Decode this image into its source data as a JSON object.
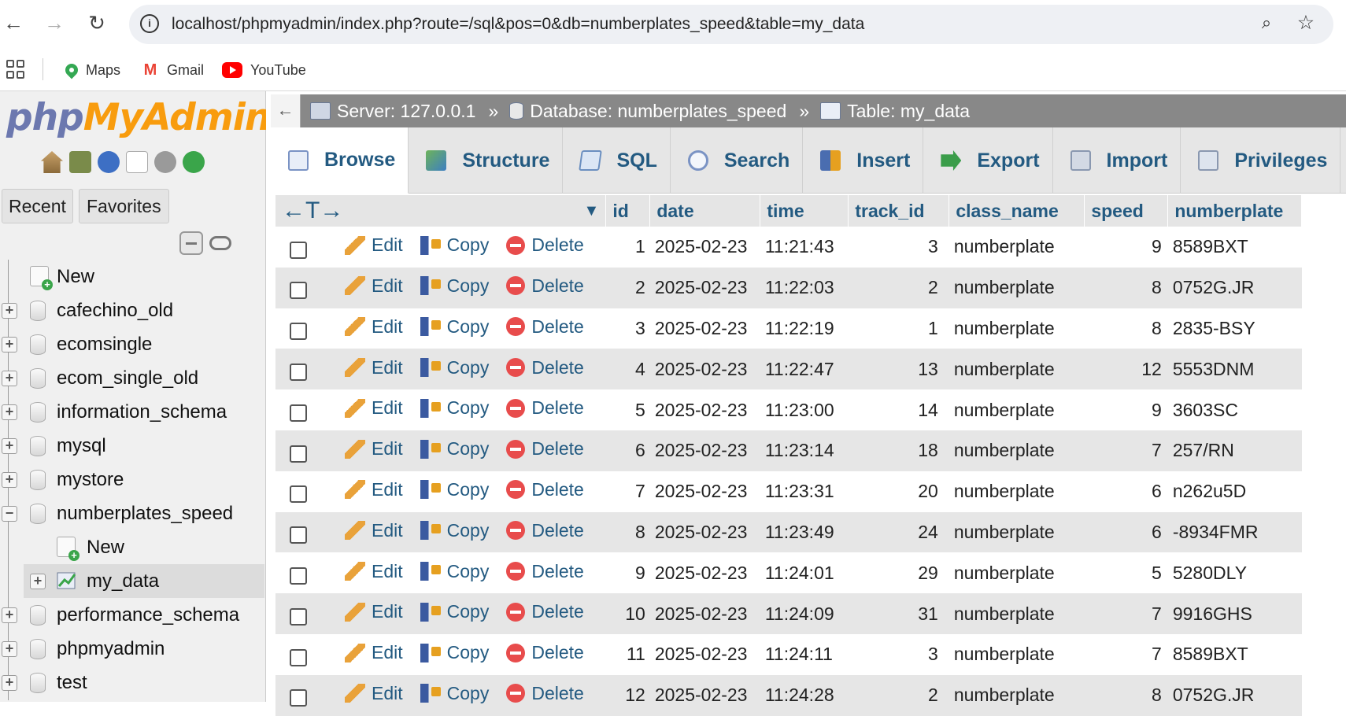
{
  "browser": {
    "url": "localhost/phpmyadmin/index.php?route=/sql&pos=0&db=numberplates_speed&table=my_data",
    "bookmarks": [
      "Maps",
      "Gmail",
      "YouTube"
    ]
  },
  "nav": {
    "logo_php": "php",
    "logo_myadmin": "MyAdmin",
    "recent_label": "Recent",
    "favorites_label": "Favorites",
    "tree": {
      "new_label": "New",
      "databases": [
        "cafechino_old",
        "ecomsingle",
        "ecom_single_old",
        "information_schema",
        "mysql",
        "mystore",
        "numberplates_speed"
      ],
      "sub_new_label": "New",
      "sub_table": "my_data",
      "databases_after": [
        "performance_schema",
        "phpmyadmin",
        "test"
      ]
    }
  },
  "breadcrumb": {
    "server": "Server: 127.0.0.1",
    "database": "Database: numberplates_speed",
    "table": "Table: my_data",
    "separator": "»"
  },
  "tabs": [
    "Browse",
    "Structure",
    "SQL",
    "Search",
    "Insert",
    "Export",
    "Import",
    "Privileges"
  ],
  "table": {
    "columns": [
      "id",
      "date",
      "time",
      "track_id",
      "class_name",
      "speed",
      "numberplate"
    ],
    "actions": {
      "edit": "Edit",
      "copy": "Copy",
      "delete": "Delete"
    },
    "rows": [
      [
        "1",
        "2025-02-23",
        "11:21:43",
        "3",
        "numberplate",
        "9",
        "8589BXT"
      ],
      [
        "2",
        "2025-02-23",
        "11:22:03",
        "2",
        "numberplate",
        "8",
        "0752G.JR"
      ],
      [
        "3",
        "2025-02-23",
        "11:22:19",
        "1",
        "numberplate",
        "8",
        "2835-BSY"
      ],
      [
        "4",
        "2025-02-23",
        "11:22:47",
        "13",
        "numberplate",
        "12",
        "5553DNM"
      ],
      [
        "5",
        "2025-02-23",
        "11:23:00",
        "14",
        "numberplate",
        "9",
        "3603SC"
      ],
      [
        "6",
        "2025-02-23",
        "11:23:14",
        "18",
        "numberplate",
        "7",
        "257/RN"
      ],
      [
        "7",
        "2025-02-23",
        "11:23:31",
        "20",
        "numberplate",
        "6",
        "n262u5D"
      ],
      [
        "8",
        "2025-02-23",
        "11:23:49",
        "24",
        "numberplate",
        "6",
        "-8934FMR"
      ],
      [
        "9",
        "2025-02-23",
        "11:24:01",
        "29",
        "numberplate",
        "5",
        "5280DLY"
      ],
      [
        "10",
        "2025-02-23",
        "11:24:09",
        "31",
        "numberplate",
        "7",
        "9916GHS"
      ],
      [
        "11",
        "2025-02-23",
        "11:24:11",
        "3",
        "numberplate",
        "7",
        "8589BXT"
      ],
      [
        "12",
        "2025-02-23",
        "11:24:28",
        "2",
        "numberplate",
        "8",
        "0752G.JR"
      ]
    ]
  }
}
